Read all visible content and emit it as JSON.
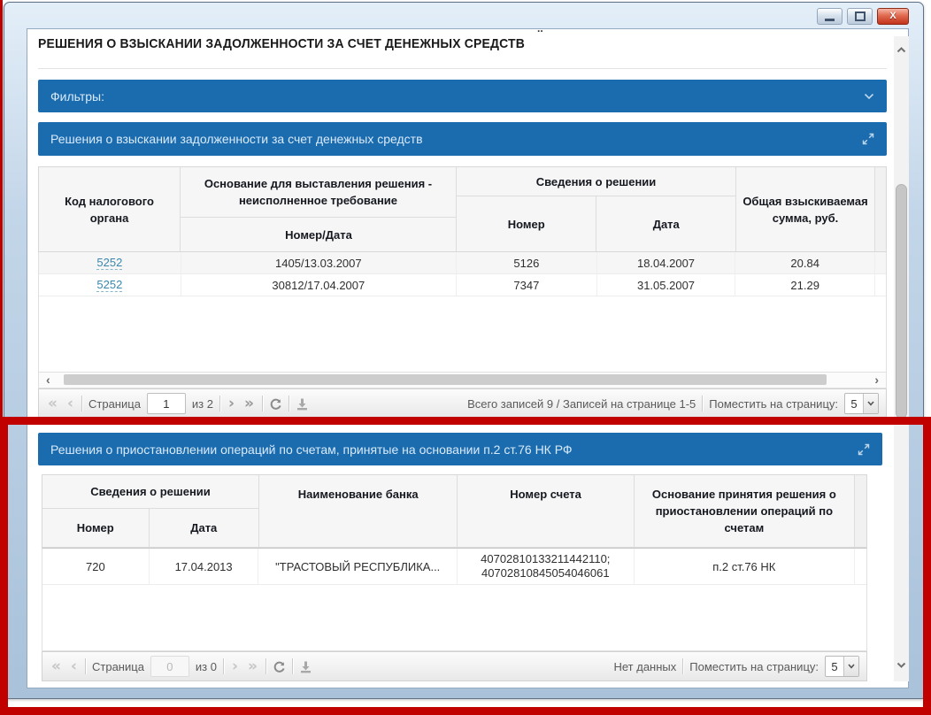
{
  "colors": {
    "accent_blue": "#1b6cae",
    "highlight_red": "#c10000",
    "link_teal": "#3a87ad"
  },
  "icons": {
    "minimize": "window-minimize dash",
    "maximize": "window-maximize square",
    "close": "window-close cross",
    "chevron_down": "collapse chevron",
    "expand": "diagonal expand arrows",
    "refresh": "circular refresh arrow",
    "download": "download arrow into tray",
    "scroll_up": "chevron up",
    "scroll_down": "chevron down"
  },
  "glyphs": {
    "first": "«",
    "prev": "‹",
    "next": "›",
    "last": "»",
    "close": "X",
    "hscroll_left": "‹",
    "hscroll_right": "›"
  },
  "page": {
    "title": "РЕШЕНИЯ О ВЗЫСКАНИИ ЗАДОЛЖЕННОСТИ ЗА СЧЕТ ДЕНЕЖНЫХ СРЕДСТВ",
    "artifact_dots": ".."
  },
  "filters_bar": {
    "label": "Фильтры:"
  },
  "section1": {
    "title": "Решения о взыскании задолженности за счет денежных средств",
    "table": {
      "code_header": "Код налогового органа",
      "basis_group": "Основание для выставления решения - неисполненное требование",
      "basis_sub": "Номер/Дата",
      "info_group": "Сведения о решении",
      "info_number": "Номер",
      "info_date": "Дата",
      "sum_header": "Общая взыскиваемая сумма, руб.",
      "rows": [
        {
          "code": "5252",
          "basis": "1405/13.03.2007",
          "number": "5126",
          "date": "18.04.2007",
          "sum": "20.84"
        },
        {
          "code": "5252",
          "basis": "30812/17.04.2007",
          "number": "7347",
          "date": "31.05.2007",
          "sum": "21.29"
        }
      ]
    },
    "paging": {
      "page_label": "Страница",
      "page_value": "1",
      "of_label": "из 2",
      "records_label": "Всего записей 9 / Записей на странице 1-5",
      "per_page_label": "Поместить на страницу:",
      "per_page_value": "5"
    }
  },
  "section2": {
    "title": "Решения о приостановлении операций по счетам, принятые на основании п.2 ст.76 НК РФ",
    "table": {
      "info_group": "Сведения о решении",
      "info_number": "Номер",
      "info_date": "Дата",
      "bank_header": "Наименование банка",
      "account_header": "Номер счета",
      "basis_header": "Основание принятия решения о приостановлении операций по счетам",
      "rows": [
        {
          "number": "720",
          "date": "17.04.2013",
          "bank": "\"ТРАСТОВЫЙ РЕСПУБЛИКА...",
          "account_line1": "40702810133211442110;",
          "account_line2": "40702810845054046061",
          "basis": "п.2 ст.76 НК"
        }
      ]
    },
    "paging": {
      "page_label": "Страница",
      "page_value": "0",
      "of_label": "из 0",
      "status": "Нет данных",
      "per_page_label": "Поместить на страницу:",
      "per_page_value": "5"
    }
  }
}
